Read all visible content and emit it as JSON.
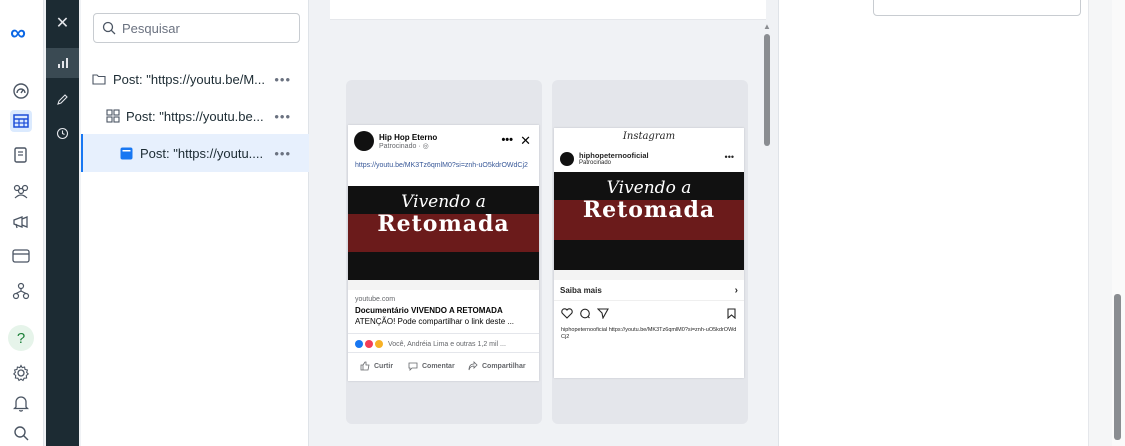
{
  "search": {
    "placeholder": "Pesquisar"
  },
  "tree": {
    "items": [
      {
        "label": "Post: \"https://youtu.be/M...",
        "more": "•••"
      },
      {
        "label": "Post: \"https://youtu.be...",
        "more": "•••"
      },
      {
        "label": "Post: \"https://youtu....",
        "more": "•••"
      }
    ]
  },
  "facebook_preview": {
    "page_name": "Hip Hop Eterno",
    "sponsored": "Patrocinado · ",
    "avatar_text": "HIP HOP ETERNO",
    "link_text": "https://youtu.be/MK3Tz6qmlM0?si=znh-uO5kdrOWdCj2",
    "image_title_1": "Vivendo a",
    "image_title_2": "Retomada",
    "domain": "youtube.com",
    "headline": "Documentário VIVENDO A RETOMADA",
    "description": "ATENÇÃO! Pode compartilhar o link deste ...",
    "reactions_text": "Você, Andréia Lima e outras 1,2 mil ...",
    "actions": [
      "Curtir",
      "Comentar",
      "Compartilhar"
    ]
  },
  "instagram_preview": {
    "header": "Instagram",
    "account": "hiphopeternooficial",
    "sponsored": "Patrocinado",
    "image_title_1": "Vivendo a",
    "image_title_2": "Retomada",
    "cta": "Saiba mais",
    "caption": "hiphopeternooficial https://youtu.be/MK3Tz6qmlM0?si=znh-uO5kdrOWdCj2"
  },
  "colors": {
    "accent": "#1877f2",
    "dark_strip": "#1c2b33",
    "selected_row": "#e7f0fd"
  }
}
